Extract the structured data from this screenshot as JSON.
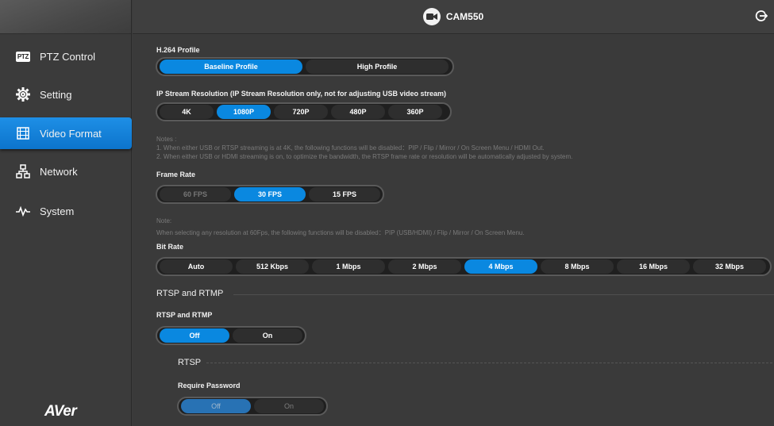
{
  "header": {
    "title": "CAM550",
    "camera_icon": "camera-icon",
    "logout_icon": "logout-icon"
  },
  "sidebar": {
    "items": [
      {
        "label": "PTZ Control",
        "icon": "ptz-icon",
        "badge": "PTZ"
      },
      {
        "label": "Setting",
        "icon": "gear-icon"
      },
      {
        "label": "Video Format",
        "icon": "film-icon",
        "active": true
      },
      {
        "label": "Network",
        "icon": "network-icon"
      },
      {
        "label": "System",
        "icon": "pulse-icon"
      }
    ],
    "logo": "AVer"
  },
  "h264": {
    "label": "H.264 Profile",
    "options": [
      "Baseline Profile",
      "High Profile"
    ],
    "selected": "Baseline Profile"
  },
  "resolution": {
    "label": "IP Stream Resolution (IP Stream Resolution only, not for adjusting USB video stream)",
    "options": [
      "4K",
      "1080P",
      "720P",
      "480P",
      "360P"
    ],
    "selected": "1080P"
  },
  "notes1": {
    "title": "Notes :",
    "line1": "1. When either USB or RTSP streaming is at 4K, the following functions will be disabled：PIP / Flip / Mirror / On Screen Menu / HDMI Out.",
    "line2": "2. When either USB or HDMI streaming is on, to optimize the bandwidth, the RTSP frame rate or resolution will be automatically adjusted by system."
  },
  "frame_rate": {
    "label": "Frame Rate",
    "options": [
      "60 FPS",
      "30 FPS",
      "15 FPS"
    ],
    "selected": "30 FPS",
    "disabled": [
      "60 FPS"
    ]
  },
  "notes2": {
    "title": "Note:",
    "line1": "When selecting any resolution at 60Fps, the following functions will be disabled：PIP (USB/HDMI) / Flip / Mirror / On Screen Menu."
  },
  "bit_rate": {
    "label": "Bit Rate",
    "options": [
      "Auto",
      "512 Kbps",
      "1 Mbps",
      "2 Mbps",
      "4 Mbps",
      "8 Mbps",
      "16 Mbps",
      "32 Mbps"
    ],
    "selected": "4 Mbps"
  },
  "rtsp_rtmp": {
    "section_title": "RTSP and RTMP",
    "label": "RTSP and RTMP",
    "options": [
      "Off",
      "On"
    ],
    "selected": "Off"
  },
  "rtsp": {
    "section_title": "RTSP",
    "password_label": "Require Password",
    "options": [
      "Off",
      "On"
    ],
    "selected": "Off"
  },
  "colors": {
    "accent": "#0a88e0",
    "background": "#3a3a3a",
    "track": "#1f1f1f"
  }
}
